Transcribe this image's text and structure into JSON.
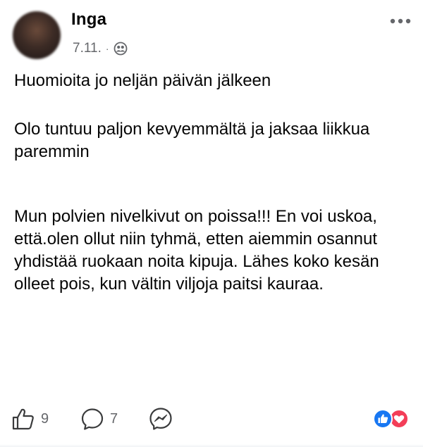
{
  "post": {
    "author": "Inga",
    "date": "7.11.",
    "separator": "·",
    "audience_icon": "friends-icon",
    "paragraphs": [
      "Huomioita jo neljän päivän jälkeen",
      "Olo tuntuu paljon kevyemmältä ja jaksaa liikkua paremmin",
      "Mun polvien nivelkivut on poissa!!! En voi uskoa, että.olen ollut niin tyhmä, etten aiemmin osannut yhdistää ruokaan noita kipuja. Lähes koko kesän olleet pois, kun vältin viljoja paitsi kauraa."
    ]
  },
  "actions": {
    "like_count": "9",
    "comment_count": "7",
    "like_icon": "thumbs-up-icon",
    "comment_icon": "comment-icon",
    "share_icon": "messenger-icon"
  },
  "reactions": {
    "icons": [
      "like-reaction-icon",
      "love-reaction-icon"
    ],
    "like_color": "#1877f2",
    "love_color": "#f33e58"
  },
  "colors": {
    "text": "#050505",
    "secondary": "#65676b"
  }
}
